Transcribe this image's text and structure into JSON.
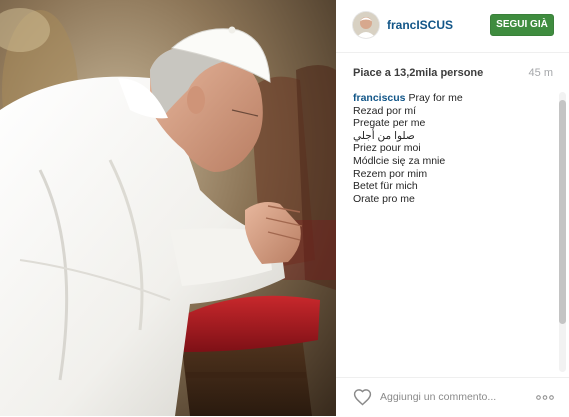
{
  "post": {
    "username": "francISCUS",
    "follow_label": "SEGUI GIÀ",
    "likes_text": "Piace a 13,2mila persone",
    "time_ago": "45 m",
    "caption": {
      "author": "franciscus",
      "lines": [
        "Pray for me",
        "Rezad por mí",
        "Pregate per me",
        "صلوا من أجلي",
        "Priez pour moi",
        "Módlcie się za mnie",
        "Rezem por mim",
        "Betet für mich",
        "Orate pro me"
      ]
    },
    "comment_placeholder": "Aggiungi un commento..."
  },
  "icons": {
    "like": "heart-outline-icon",
    "more": "more-options-icon"
  },
  "colors": {
    "username": "#125688",
    "follow_button": "#3f8c3f",
    "muted_text": "#a5a7aa"
  }
}
